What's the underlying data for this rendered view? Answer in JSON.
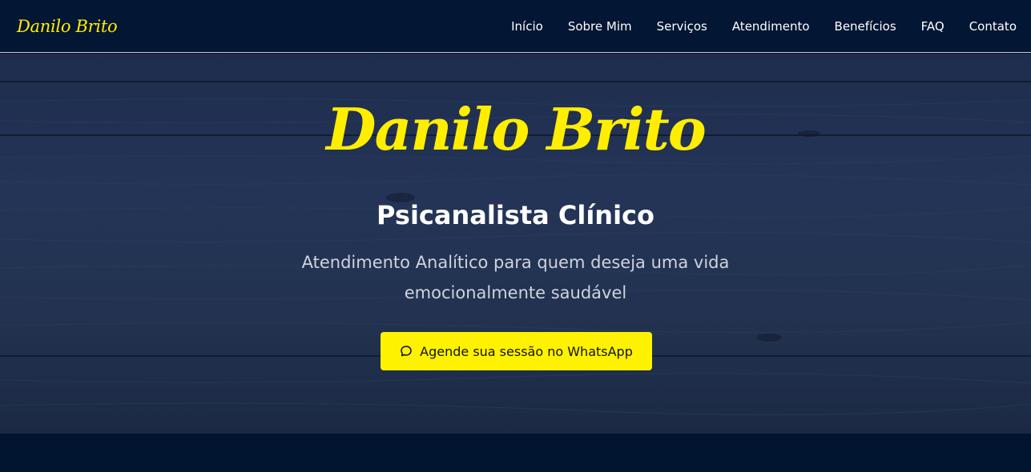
{
  "brand": {
    "logo_text": "Danilo Brito"
  },
  "nav": {
    "items": [
      {
        "label": "Início"
      },
      {
        "label": "Sobre Mim"
      },
      {
        "label": "Serviços"
      },
      {
        "label": "Atendimento"
      },
      {
        "label": "Benefícios"
      },
      {
        "label": "FAQ"
      },
      {
        "label": "Contato"
      }
    ]
  },
  "hero": {
    "name": "Danilo Brito",
    "role": "Psicanalista Clínico",
    "tagline": "Atendimento Analítico para quem deseja uma vida emocionalmente saudável",
    "cta": {
      "label": "Agende sua sessão no WhatsApp",
      "icon": "chat-bubble-icon"
    }
  },
  "colors": {
    "accent": "#ffee00",
    "nav_background": "#031633",
    "hero_background": "#22324f",
    "button_background": "#fff200"
  }
}
